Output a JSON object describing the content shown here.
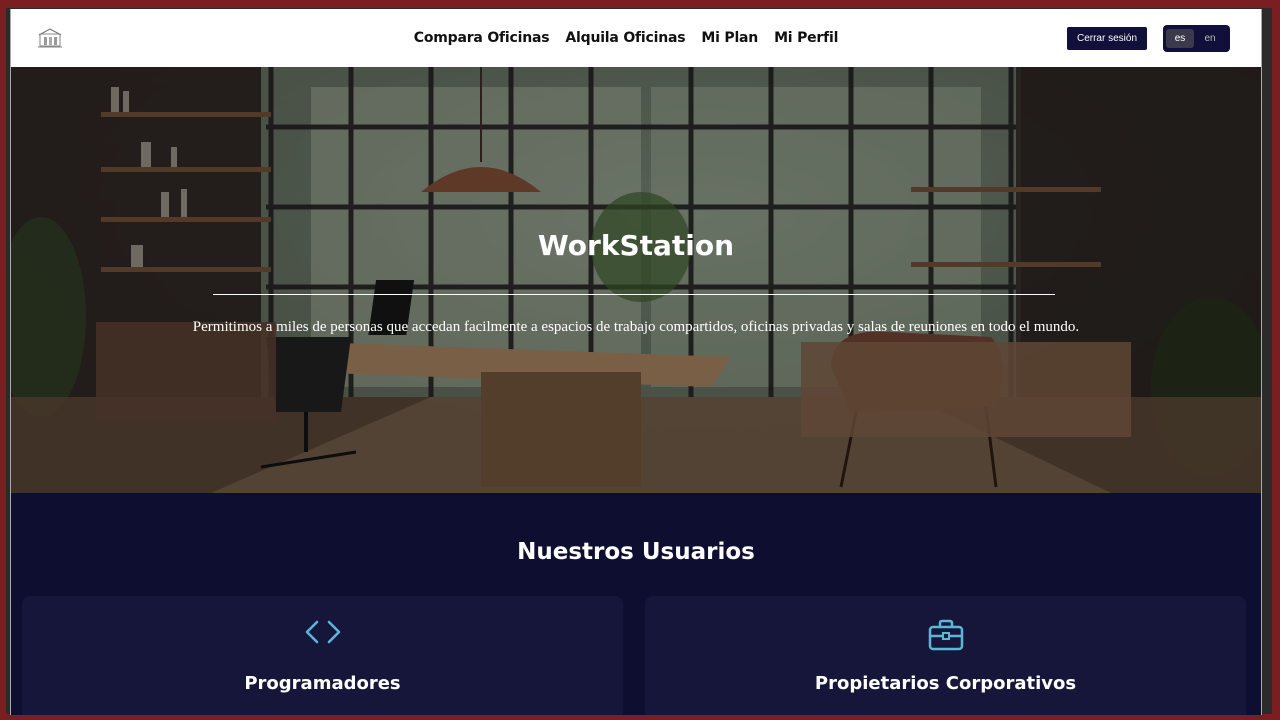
{
  "nav": {
    "links": [
      "Compara Oficinas",
      "Alquila Oficinas",
      "Mi Plan",
      "Mi Perfil"
    ],
    "logout_label": "Cerrar sesión",
    "languages": [
      "es",
      "en"
    ],
    "active_language": "es"
  },
  "hero": {
    "title": "WorkStation",
    "subtitle": "Permitimos a miles de personas que accedan facilmente a espacios de trabajo compartidos, oficinas privadas y salas de reuniones en todo el mundo."
  },
  "users": {
    "title": "Nuestros Usuarios",
    "cards": [
      {
        "title": "Programadores",
        "icon": "code-icon"
      },
      {
        "title": "Propietarios Corporativos",
        "icon": "briefcase-icon"
      }
    ]
  },
  "colors": {
    "navy": "#10103a",
    "section_bg": "#0e0e30",
    "card_bg": "#16163a",
    "icon_accent": "#5ab8d6"
  }
}
